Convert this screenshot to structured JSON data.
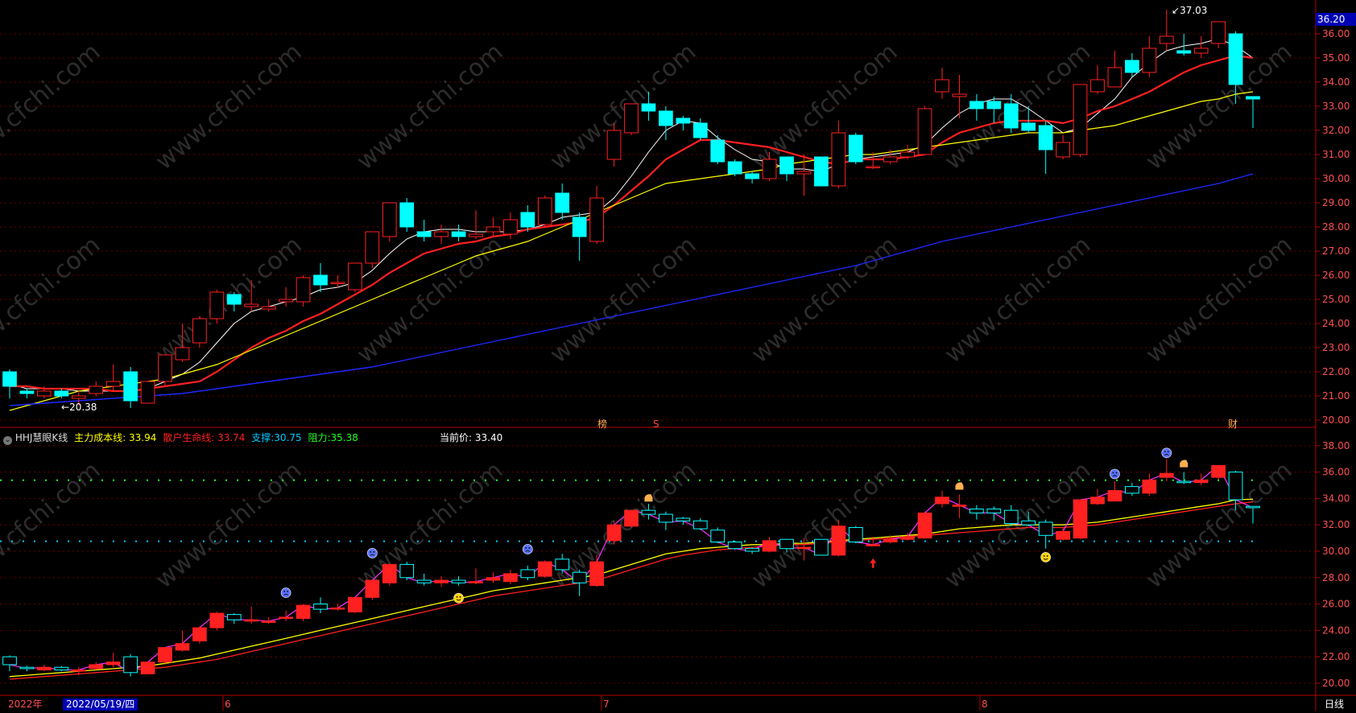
{
  "upper_panel": {
    "current_price_tag": "36.20",
    "high_label": "37.03",
    "low_label": "20.38",
    "event_markers": [
      "榜",
      "S",
      "财"
    ]
  },
  "lower_panel": {
    "indicator_title": "HHJ慧眼K线",
    "legend": [
      {
        "label": "主力成本线:",
        "value": "33.94",
        "color": "#ffff00"
      },
      {
        "label": "散户生命线:",
        "value": "33.74",
        "color": "#ff2020"
      },
      {
        "label": "支撑:",
        "value": "30.75",
        "color": "#00c8ff"
      },
      {
        "label": "阻力:",
        "value": "35.38",
        "color": "#20ff20"
      }
    ],
    "current_price_label": "当前价:",
    "current_price_value": "33.40"
  },
  "bottom_bar": {
    "year_label": "2022年",
    "date_cursor": "2022/05/19/四",
    "month_labels": [
      "6",
      "7",
      "8"
    ],
    "period_label": "日线"
  },
  "watermark": "www.cfchi.com",
  "colors": {
    "up": "#ff2020",
    "down": "#00ffff",
    "ma5": "#ffffff",
    "ma10": "#ff2020",
    "ma20": "#ffff00",
    "ma60": "#1e28ff",
    "axis": "#b40000"
  },
  "chart_data": [
    {
      "type": "candlestick",
      "panel": "main",
      "y_ticks": [
        "36.00",
        "35.00",
        "34.00",
        "33.00",
        "32.00",
        "31.00",
        "30.00",
        "29.00",
        "28.00",
        "27.00",
        "26.00",
        "25.00",
        "24.00",
        "23.00",
        "22.00",
        "21.00",
        "20.00"
      ],
      "ylim": [
        19.8,
        37.2
      ],
      "candles": [
        [
          22.0,
          21.4,
          22.1,
          20.9
        ],
        [
          21.2,
          21.1,
          21.3,
          20.9
        ],
        [
          21.0,
          21.2,
          21.4,
          20.9
        ],
        [
          21.2,
          21.0,
          21.3,
          20.9
        ],
        [
          20.9,
          21.0,
          21.2,
          20.6
        ],
        [
          21.1,
          21.4,
          21.6,
          21.0
        ],
        [
          21.4,
          21.6,
          22.3,
          21.2
        ],
        [
          22.0,
          20.8,
          22.2,
          20.5
        ],
        [
          20.7,
          21.6,
          21.6,
          20.7
        ],
        [
          21.6,
          22.7,
          22.7,
          21.4
        ],
        [
          22.5,
          23.0,
          24.0,
          22.4
        ],
        [
          23.2,
          24.2,
          24.3,
          23.0
        ],
        [
          24.2,
          25.3,
          25.4,
          24.0
        ],
        [
          25.2,
          24.8,
          25.3,
          24.5
        ],
        [
          24.7,
          24.8,
          25.8,
          24.5
        ],
        [
          24.6,
          24.7,
          25.0,
          24.5
        ],
        [
          24.9,
          25.0,
          25.5,
          24.7
        ],
        [
          24.9,
          25.9,
          26.0,
          24.7
        ],
        [
          26.0,
          25.6,
          26.5,
          25.3
        ],
        [
          25.7,
          25.7,
          26.0,
          25.5
        ],
        [
          25.4,
          26.5,
          26.5,
          25.3
        ],
        [
          26.5,
          27.8,
          27.8,
          26.3
        ],
        [
          27.6,
          29.0,
          29.0,
          27.4
        ],
        [
          29.0,
          28.0,
          29.2,
          27.8
        ],
        [
          27.8,
          27.6,
          28.3,
          27.4
        ],
        [
          27.6,
          27.8,
          28.1,
          27.3
        ],
        [
          27.8,
          27.6,
          28.1,
          27.4
        ],
        [
          27.6,
          27.7,
          28.7,
          27.5
        ],
        [
          27.8,
          28.0,
          28.4,
          27.6
        ],
        [
          27.7,
          28.3,
          28.6,
          27.5
        ],
        [
          28.6,
          28.0,
          28.9,
          27.8
        ],
        [
          28.1,
          29.2,
          29.3,
          28.0
        ],
        [
          29.4,
          28.6,
          29.8,
          28.3
        ],
        [
          28.4,
          27.6,
          28.6,
          26.6
        ],
        [
          27.4,
          29.2,
          29.7,
          27.3
        ],
        [
          30.8,
          32.0,
          32.3,
          30.5
        ],
        [
          31.9,
          33.1,
          33.1,
          31.8
        ],
        [
          33.1,
          32.8,
          33.6,
          32.4
        ],
        [
          32.8,
          32.2,
          33.0,
          31.6
        ],
        [
          32.5,
          32.3,
          32.6,
          32.0
        ],
        [
          32.3,
          31.7,
          32.5,
          31.6
        ],
        [
          31.6,
          30.7,
          31.8,
          30.6
        ],
        [
          30.7,
          30.2,
          30.8,
          30.1
        ],
        [
          30.2,
          30.0,
          30.3,
          29.8
        ],
        [
          30.0,
          30.8,
          31.1,
          29.9
        ],
        [
          30.9,
          30.2,
          30.9,
          29.9
        ],
        [
          30.2,
          30.3,
          31.0,
          29.3
        ],
        [
          30.9,
          29.7,
          30.9,
          29.7
        ],
        [
          29.7,
          31.9,
          32.4,
          29.6
        ],
        [
          31.8,
          30.7,
          31.9,
          30.6
        ],
        [
          30.5,
          30.5,
          31.1,
          30.4
        ],
        [
          30.7,
          30.9,
          31.2,
          30.6
        ],
        [
          30.9,
          31.1,
          31.4,
          30.8
        ],
        [
          31.0,
          32.9,
          33.0,
          31.0
        ],
        [
          33.6,
          34.1,
          34.6,
          33.3
        ],
        [
          33.4,
          33.5,
          34.3,
          32.5
        ],
        [
          33.2,
          32.9,
          33.5,
          32.4
        ],
        [
          33.2,
          32.9,
          33.4,
          32.3
        ],
        [
          33.1,
          32.1,
          33.5,
          31.9
        ],
        [
          32.3,
          32.0,
          33.0,
          31.9
        ],
        [
          32.2,
          31.2,
          32.4,
          30.2
        ],
        [
          30.9,
          31.5,
          31.8,
          30.8
        ],
        [
          31.0,
          33.9,
          33.9,
          30.9
        ],
        [
          33.6,
          34.1,
          34.7,
          33.5
        ],
        [
          33.8,
          34.6,
          35.3,
          33.8
        ],
        [
          34.9,
          34.4,
          35.2,
          34.2
        ],
        [
          34.4,
          35.4,
          35.9,
          34.2
        ],
        [
          35.6,
          35.9,
          37.0,
          35.3
        ],
        [
          35.3,
          35.2,
          36.0,
          35.1
        ],
        [
          35.2,
          35.4,
          35.9,
          35.0
        ],
        [
          35.6,
          36.5,
          36.5,
          35.4
        ],
        [
          36.0,
          33.9,
          36.1,
          33.1
        ],
        [
          33.4,
          33.3,
          33.4,
          32.1
        ]
      ],
      "series": [
        {
          "name": "MA5",
          "values": [
            21.5,
            21.3,
            21.3,
            21.3,
            21.2,
            21.2,
            21.2,
            21.2,
            21.3,
            21.6,
            21.9,
            22.4,
            23.2,
            24.0,
            24.5,
            24.7,
            24.9,
            25.1,
            25.4,
            25.5,
            25.7,
            26.2,
            26.9,
            27.5,
            27.8,
            27.9,
            27.9,
            27.8,
            27.8,
            27.8,
            27.9,
            28.1,
            28.4,
            28.5,
            28.6,
            29.2,
            30.1,
            31.1,
            32.0,
            32.4,
            32.3,
            31.7,
            31.2,
            30.8,
            30.7,
            30.4,
            30.4,
            30.3,
            30.6,
            30.8,
            30.9,
            31.0,
            31.1,
            31.4,
            32.1,
            32.7,
            33.1,
            33.3,
            33.3,
            32.9,
            32.4,
            31.9,
            32.1,
            32.7,
            33.3,
            34.2,
            34.8,
            35.3,
            35.5,
            35.6,
            35.8,
            35.5,
            35.0
          ]
        },
        {
          "name": "MA10",
          "values": [
            21.4,
            21.4,
            21.3,
            21.3,
            21.3,
            21.3,
            21.2,
            21.2,
            21.3,
            21.4,
            21.5,
            21.6,
            22.0,
            22.5,
            23.0,
            23.4,
            23.7,
            24.1,
            24.4,
            24.8,
            25.2,
            25.6,
            26.1,
            26.5,
            26.9,
            27.1,
            27.3,
            27.4,
            27.6,
            27.7,
            27.9,
            28.0,
            28.1,
            28.2,
            28.4,
            28.9,
            29.5,
            30.1,
            30.8,
            31.2,
            31.6,
            31.6,
            31.5,
            31.4,
            31.3,
            31.1,
            30.9,
            30.7,
            30.6,
            30.8,
            30.8,
            30.8,
            30.9,
            31.0,
            31.5,
            31.9,
            32.1,
            32.3,
            32.4,
            32.4,
            32.4,
            32.3,
            32.5,
            32.8,
            33.0,
            33.3,
            33.6,
            34.0,
            34.4,
            34.7,
            34.9,
            35.1,
            35.0
          ]
        },
        {
          "name": "MA20",
          "values": [
            20.4,
            20.6,
            20.8,
            21.0,
            21.2,
            21.3,
            21.4,
            21.5,
            21.6,
            21.7,
            21.9,
            22.1,
            22.3,
            22.6,
            22.9,
            23.2,
            23.5,
            23.8,
            24.1,
            24.4,
            24.7,
            25.0,
            25.3,
            25.6,
            25.9,
            26.2,
            26.5,
            26.8,
            27.0,
            27.2,
            27.4,
            27.7,
            28.0,
            28.3,
            28.6,
            28.9,
            29.2,
            29.5,
            29.8,
            29.9,
            30.0,
            30.1,
            30.2,
            30.3,
            30.4,
            30.6,
            30.7,
            30.8,
            30.9,
            31.0,
            31.0,
            31.1,
            31.2,
            31.3,
            31.4,
            31.5,
            31.6,
            31.7,
            31.8,
            31.9,
            31.9,
            31.9,
            32.0,
            32.1,
            32.2,
            32.4,
            32.6,
            32.8,
            33.0,
            33.2,
            33.3,
            33.5,
            33.6
          ]
        },
        {
          "name": "MA60",
          "values": [
            20.6,
            20.65,
            20.7,
            20.75,
            20.8,
            20.85,
            20.9,
            20.95,
            21.0,
            21.05,
            21.1,
            21.2,
            21.3,
            21.4,
            21.5,
            21.6,
            21.7,
            21.8,
            21.9,
            22.0,
            22.1,
            22.2,
            22.35,
            22.5,
            22.65,
            22.8,
            22.95,
            23.1,
            23.25,
            23.4,
            23.55,
            23.7,
            23.85,
            24.0,
            24.15,
            24.3,
            24.45,
            24.6,
            24.75,
            24.9,
            25.05,
            25.2,
            25.35,
            25.5,
            25.65,
            25.8,
            25.95,
            26.1,
            26.25,
            26.4,
            26.6,
            26.8,
            27.0,
            27.2,
            27.4,
            27.55,
            27.7,
            27.85,
            28.0,
            28.15,
            28.3,
            28.45,
            28.6,
            28.75,
            28.9,
            29.05,
            29.2,
            29.35,
            29.5,
            29.65,
            29.8,
            30.0,
            30.2
          ]
        }
      ]
    },
    {
      "type": "candlestick",
      "panel": "indicator",
      "y_ticks": [
        "38.00",
        "36.00",
        "34.00",
        "32.00",
        "30.00",
        "28.00",
        "26.00",
        "24.00",
        "22.00",
        "20.00"
      ],
      "ylim": [
        19.2,
        38.6
      ],
      "resistance": 35.38,
      "support": 30.75,
      "series": [
        {
          "name": "主力成本线",
          "values": [
            20.5,
            20.6,
            20.7,
            20.8,
            20.9,
            21.0,
            21.1,
            21.2,
            21.3,
            21.5,
            21.7,
            21.9,
            22.2,
            22.5,
            22.8,
            23.1,
            23.4,
            23.7,
            24.0,
            24.3,
            24.6,
            24.9,
            25.2,
            25.5,
            25.8,
            26.1,
            26.4,
            26.7,
            27.0,
            27.2,
            27.4,
            27.6,
            27.8,
            28.0,
            28.2,
            28.6,
            29.0,
            29.4,
            29.8,
            30.0,
            30.2,
            30.3,
            30.4,
            30.5,
            30.5,
            30.6,
            30.6,
            30.7,
            30.8,
            30.9,
            31.0,
            31.1,
            31.2,
            31.3,
            31.5,
            31.7,
            31.8,
            31.9,
            32.0,
            32.0,
            32.0,
            32.0,
            32.1,
            32.2,
            32.4,
            32.6,
            32.8,
            33.0,
            33.2,
            33.4,
            33.6,
            33.9,
            33.94
          ]
        },
        {
          "name": "散户生命线",
          "values": [
            20.3,
            20.4,
            20.5,
            20.6,
            20.7,
            20.8,
            20.9,
            21.0,
            21.1,
            21.2,
            21.4,
            21.6,
            21.8,
            22.1,
            22.4,
            22.7,
            23.0,
            23.3,
            23.6,
            23.9,
            24.2,
            24.5,
            24.8,
            25.1,
            25.4,
            25.7,
            26.0,
            26.3,
            26.6,
            26.8,
            27.0,
            27.2,
            27.4,
            27.6,
            27.8,
            28.2,
            28.6,
            29.0,
            29.4,
            29.7,
            29.9,
            30.1,
            30.2,
            30.3,
            30.4,
            30.5,
            30.5,
            30.6,
            30.7,
            30.8,
            30.9,
            31.0,
            31.1,
            31.2,
            31.3,
            31.4,
            31.5,
            31.6,
            31.7,
            31.8,
            31.8,
            31.8,
            31.9,
            32.0,
            32.2,
            32.4,
            32.6,
            32.8,
            33.0,
            33.2,
            33.4,
            33.6,
            33.74
          ]
        }
      ]
    }
  ]
}
